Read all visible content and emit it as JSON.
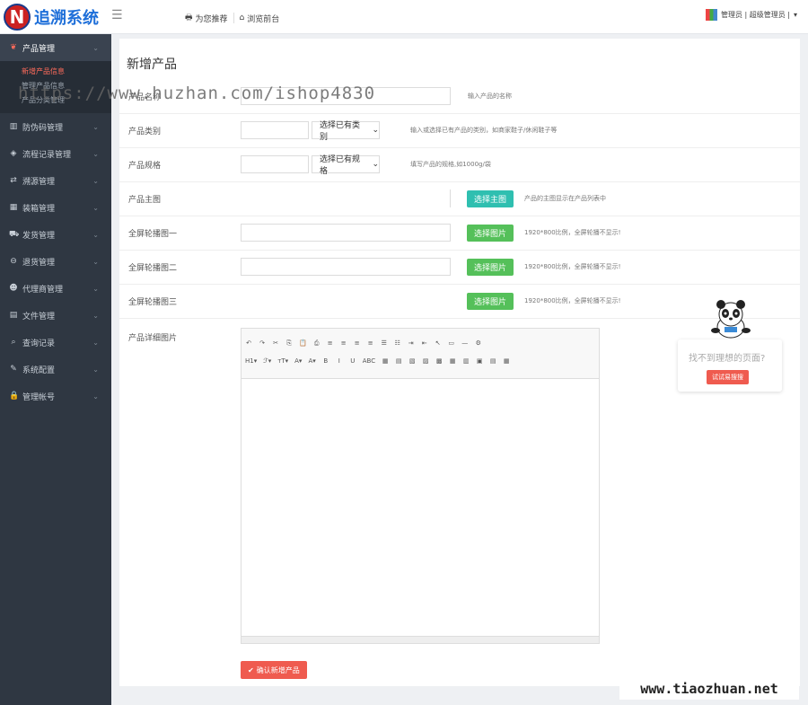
{
  "header": {
    "logo_mark": "N",
    "app_title": "追溯系统",
    "nav": [
      {
        "label": "为您推荐",
        "icon": "printer-icon"
      },
      {
        "label": "浏览前台",
        "icon": "home-icon"
      }
    ],
    "user_label": "管理员 | 超级管理员 |"
  },
  "sidebar": {
    "items": [
      {
        "label": "产品管理",
        "active": true
      },
      {
        "label": "防伪码管理"
      },
      {
        "label": "流程记录管理"
      },
      {
        "label": "溯源管理"
      },
      {
        "label": "装箱管理"
      },
      {
        "label": "发货管理"
      },
      {
        "label": "退货管理"
      },
      {
        "label": "代理商管理"
      },
      {
        "label": "文件管理"
      },
      {
        "label": "查询记录"
      },
      {
        "label": "系统配置"
      },
      {
        "label": "管理帐号"
      }
    ],
    "subitems": [
      {
        "label": "新增产品信息",
        "current": true
      },
      {
        "label": "管理产品信息"
      },
      {
        "label": "产品分类管理"
      }
    ]
  },
  "form": {
    "title": "新增产品",
    "rows": [
      {
        "label": "产品名称",
        "hint": "输入产品的名称"
      },
      {
        "label": "产品类别",
        "select": "选择已有类别",
        "hint": "输入或选择已有产品的类别，如商家鞋子/休闲鞋子等"
      },
      {
        "label": "产品规格",
        "select": "选择已有规格",
        "hint": "填写产品的规格,如1000g/袋"
      },
      {
        "label": "产品主图",
        "button": "选择主图",
        "hint": "产品的主图显示在产品列表中"
      },
      {
        "label": "全屏轮播图一",
        "button": "选择图片",
        "hint": "1920*800比例，全屏轮播不显示!"
      },
      {
        "label": "全屏轮播图二",
        "button": "选择图片",
        "hint": "1920*800比例，全屏轮播不显示!"
      },
      {
        "label": "全屏轮播图三",
        "button": "选择图片",
        "hint": "1920*800比例，全屏轮播不显示!"
      }
    ],
    "detail_label": "产品详细图片",
    "submit_label": "确认新增产品"
  },
  "editor": {
    "toolbar_row1": [
      "↶",
      "↷",
      "✂",
      "⎘",
      "📋",
      "⎙",
      "≡",
      "≡",
      "≡",
      "≡",
      "☰",
      "☷",
      "⇥",
      "⇤",
      "↖",
      "▭",
      "—",
      "⚙"
    ],
    "toolbar_row2": [
      "H1▾",
      "ℱ▾",
      "тT▾",
      "A▾",
      "A▾",
      "B",
      "I",
      "U",
      "ABC",
      "▦",
      "▤",
      "▧",
      "▨",
      "▩",
      "▦",
      "▥",
      "▣",
      "▤",
      "▦"
    ]
  },
  "widget": {
    "question": "找不到理想的页面?",
    "button": "试试易搜搜"
  },
  "watermarks": {
    "top": "https://www.huzhan.com/ishop4830",
    "bottom": "www.tiaozhuan.net"
  }
}
